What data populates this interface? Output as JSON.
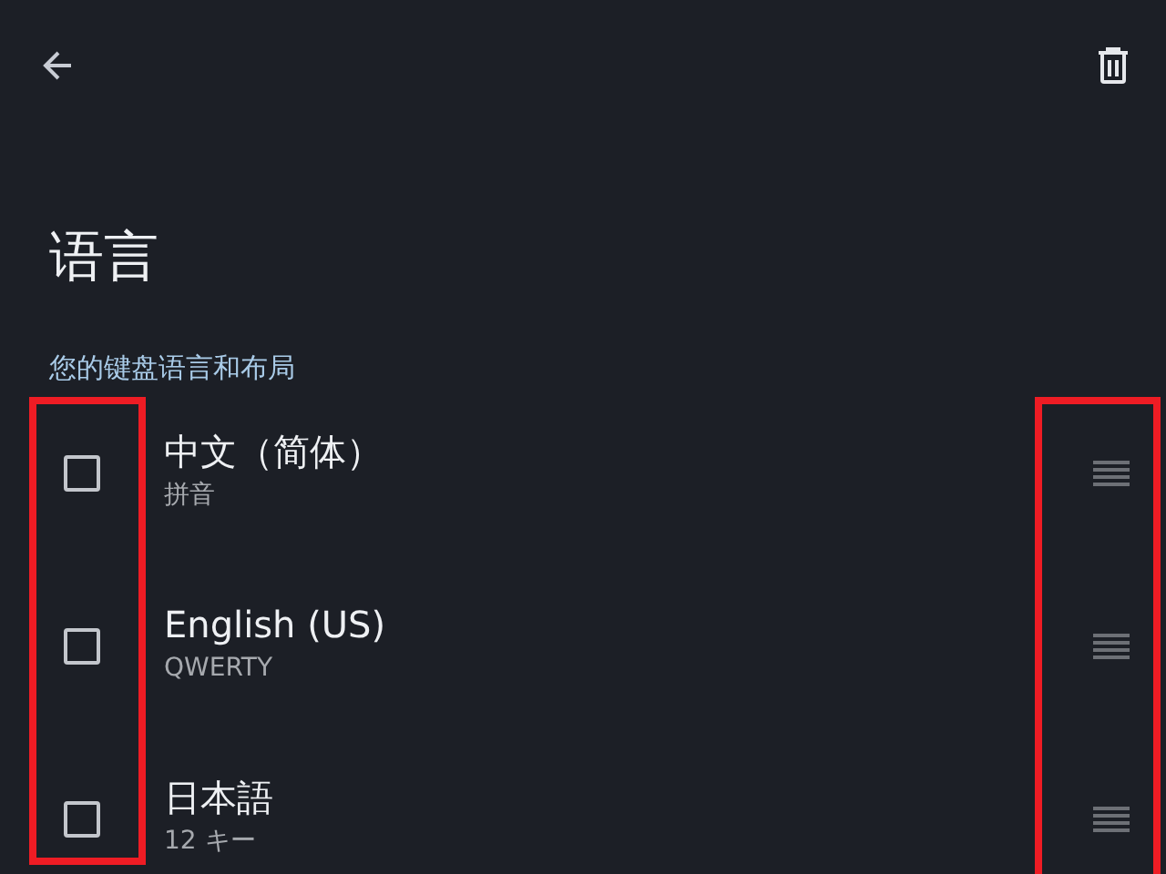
{
  "title": "语言",
  "section": "您的键盘语言和布局",
  "languages": [
    {
      "name": "中文（简体）",
      "layout": "拼音",
      "checked": false
    },
    {
      "name": "English (US)",
      "layout": "QWERTY",
      "checked": false
    },
    {
      "name": "日本語",
      "layout": "12 キー",
      "checked": false
    }
  ]
}
